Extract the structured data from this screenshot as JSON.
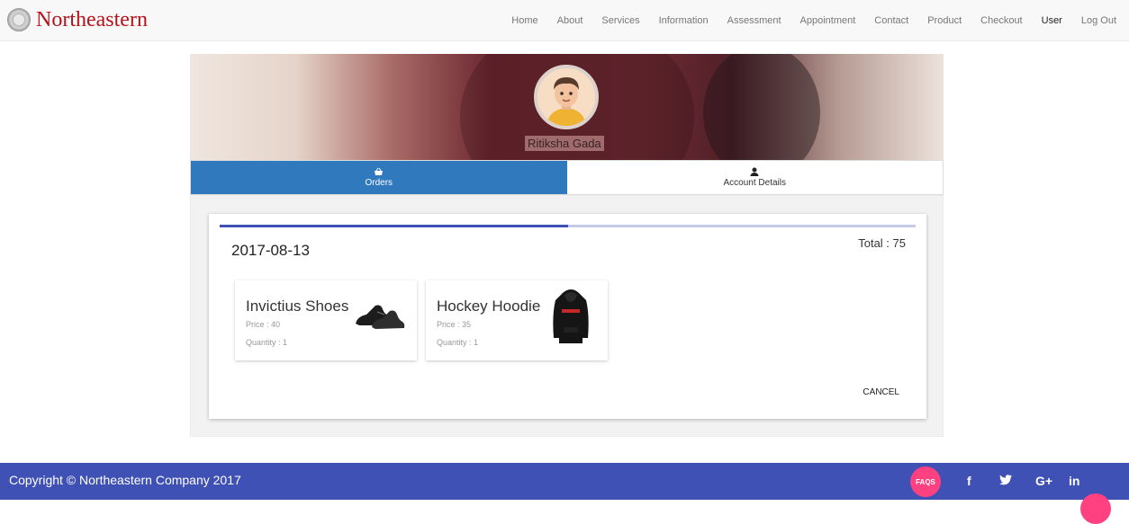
{
  "brand": {
    "name": "Northeastern"
  },
  "nav": [
    {
      "label": "Home"
    },
    {
      "label": "About"
    },
    {
      "label": "Services"
    },
    {
      "label": "Information"
    },
    {
      "label": "Assessment"
    },
    {
      "label": "Appointment"
    },
    {
      "label": "Contact"
    },
    {
      "label": "Product"
    },
    {
      "label": "Checkout"
    },
    {
      "label": "User",
      "active": true
    },
    {
      "label": "Log Out"
    }
  ],
  "profile": {
    "name": "Ritiksha Gada"
  },
  "tabs": [
    {
      "label": "Orders",
      "icon": "basket-icon",
      "active": true
    },
    {
      "label": "Account Details",
      "icon": "user-icon",
      "active": false
    }
  ],
  "order": {
    "date": "2017-08-13",
    "total": "Total : 75",
    "progress_fraction": 0.5,
    "cancel_label": "CANCEL",
    "items": [
      {
        "name": "Invictius Shoes",
        "price": "Price : 40",
        "quantity": "Quantity : 1",
        "icon": "shoes-image"
      },
      {
        "name": "Hockey Hoodie",
        "price": "Price : 35",
        "quantity": "Quantity : 1",
        "icon": "hoodie-image"
      }
    ]
  },
  "footer": {
    "copyright": "Copyright © Northeastern Company 2017",
    "faqs": "FAQS",
    "social": [
      {
        "label": "f",
        "icon": "facebook-icon"
      },
      {
        "label": "𝕪",
        "icon": "twitter-icon"
      },
      {
        "label": "G+",
        "icon": "google-plus-icon"
      },
      {
        "label": "in",
        "icon": "linkedin-icon"
      }
    ]
  },
  "colors": {
    "brand": "#b5121b",
    "tab_active": "#3079bd",
    "footer": "#3f51b5",
    "accent": "#ff4081"
  }
}
